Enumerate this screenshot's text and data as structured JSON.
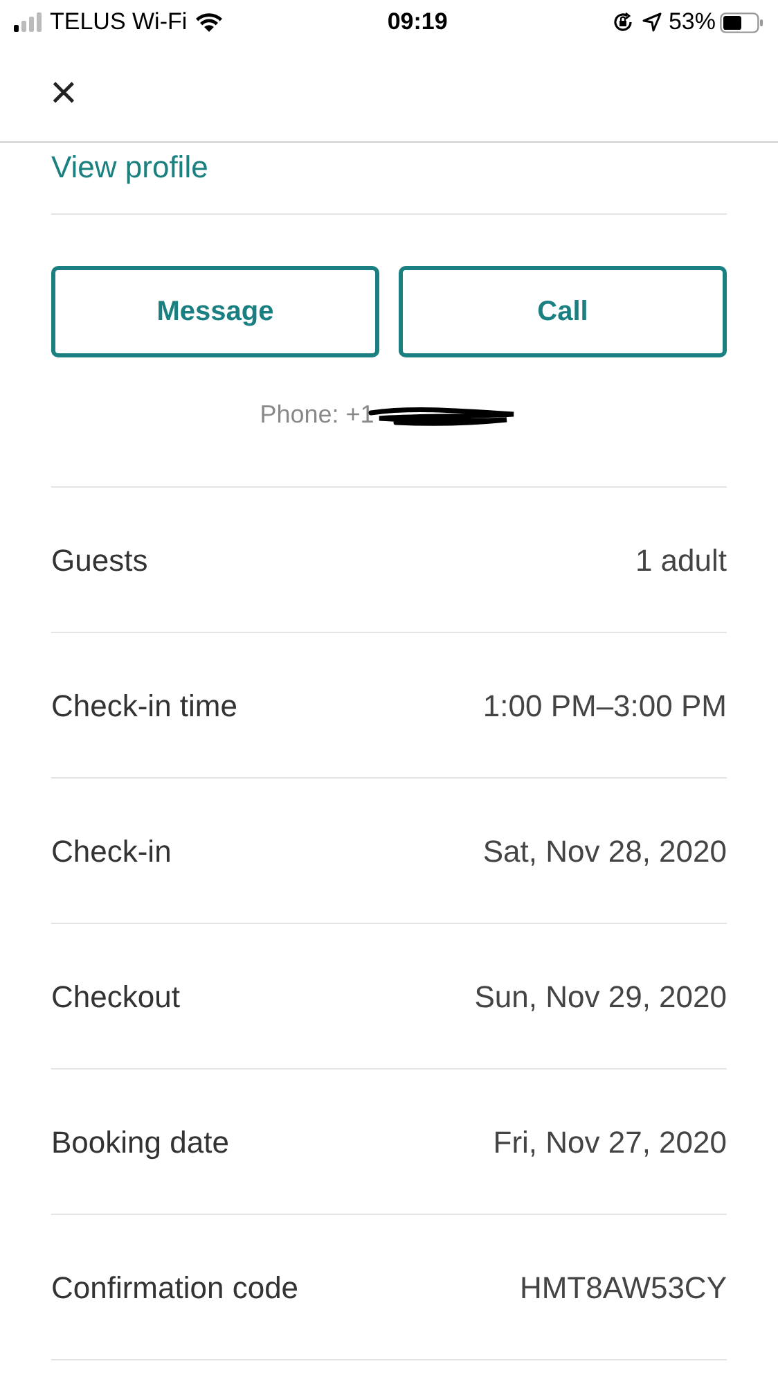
{
  "status_bar": {
    "carrier": "TELUS Wi-Fi",
    "time": "09:19",
    "battery": "53%"
  },
  "header": {
    "close": "×"
  },
  "profile_link": "View profile",
  "buttons": [
    "Message",
    "Call"
  ],
  "phone": "Phone: +1",
  "details": [
    {
      "label": "Guests",
      "value": "1 adult"
    },
    {
      "label": "Check-in time",
      "value": "1:00 PM–3:00 PM"
    },
    {
      "label": "Check-in",
      "value": "Sat, Nov 28, 2020"
    },
    {
      "label": "Checkout",
      "value": "Sun, Nov 29, 2020"
    },
    {
      "label": "Booking date",
      "value": "Fri, Nov 27, 2020"
    },
    {
      "label": "Confirmation code",
      "value": "HMT8AW53CY"
    }
  ]
}
